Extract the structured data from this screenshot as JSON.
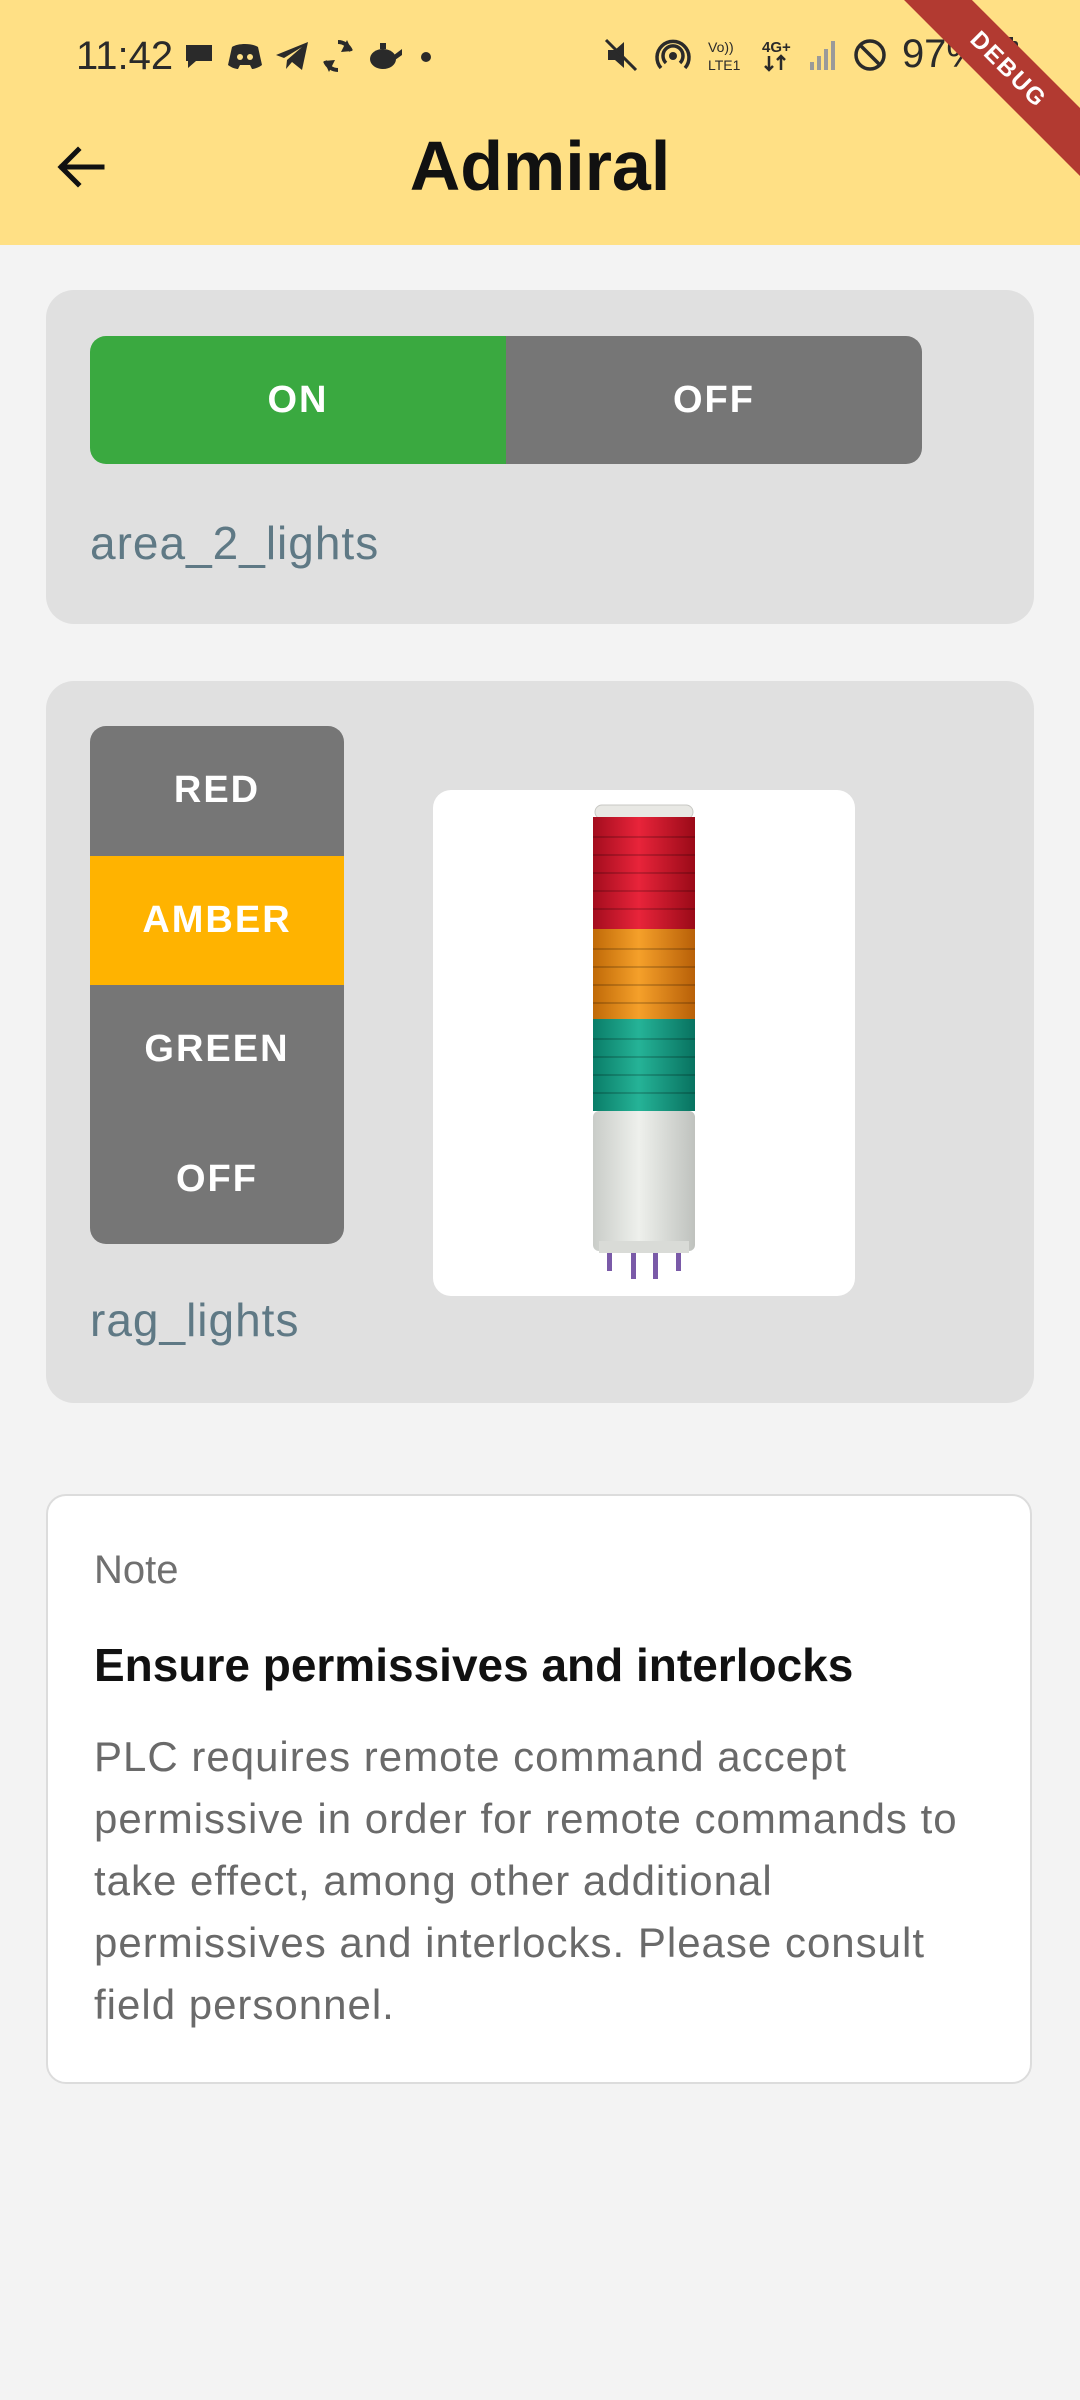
{
  "status_bar": {
    "time": "11:42",
    "battery": "97%",
    "network": "4G+",
    "notification_icons": [
      "chat-icon",
      "discord-icon",
      "telegram-icon",
      "sync-icon",
      "teapot-icon",
      "dot-icon"
    ],
    "system_icons": [
      "mute-icon",
      "hotspot-icon",
      "volte-icon",
      "4g-icon",
      "signal-icon",
      "dnd-icon",
      "battery-icon"
    ]
  },
  "debug_banner": "DEBUG",
  "app_bar": {
    "title": "Admiral",
    "back_icon": "arrow-left-icon"
  },
  "card1": {
    "options": [
      "ON",
      "OFF"
    ],
    "selected": "ON",
    "label": "area_2_lights",
    "colors": {
      "on": "#3aa940",
      "off": "#767676"
    }
  },
  "card2": {
    "options": [
      "RED",
      "AMBER",
      "GREEN",
      "OFF"
    ],
    "selected": "AMBER",
    "label": "rag_lights",
    "image": "stack-light-tower",
    "colors": {
      "selected": "#ffb300",
      "unselected": "#767676"
    }
  },
  "note": {
    "kicker": "Note",
    "title": "Ensure permissives and interlocks",
    "body": "PLC requires remote command accept permissive in order for remote commands to take effect, among other additional permissives and interlocks. Please consult field personnel."
  },
  "colors": {
    "app_bar": "#ffe085",
    "background": "#f3f3f3",
    "card": "#e0e0e0",
    "label": "#5f7985"
  }
}
